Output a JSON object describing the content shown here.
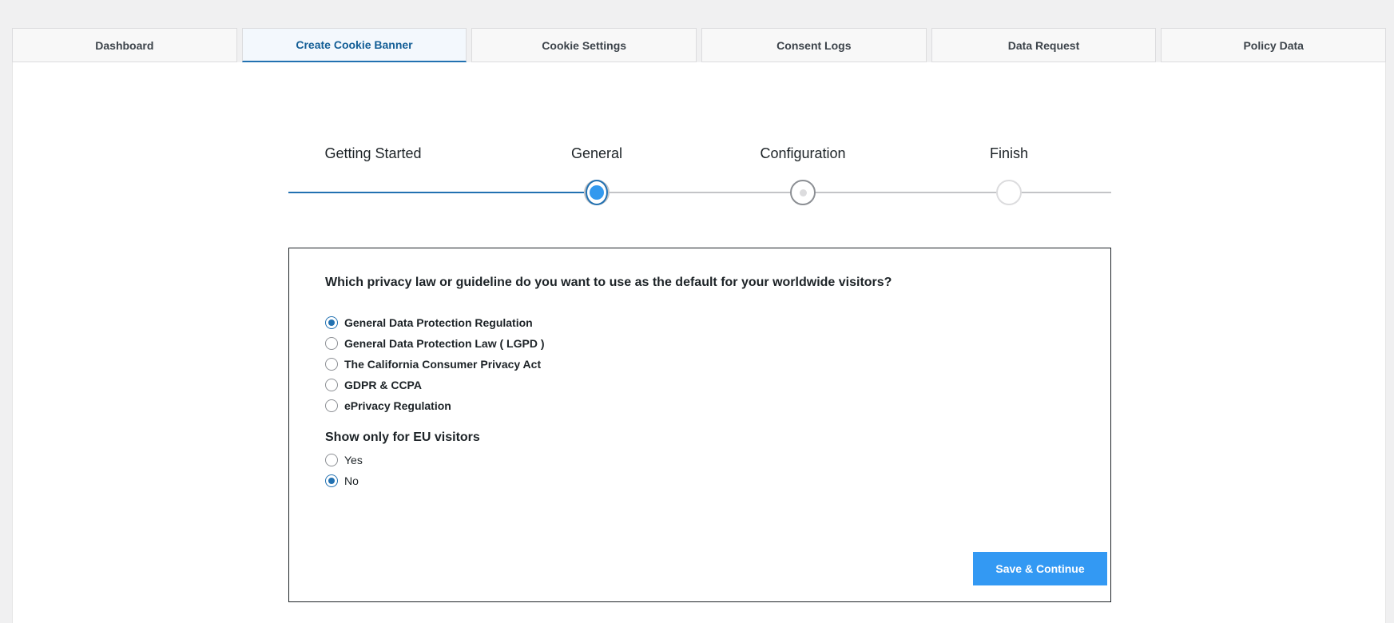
{
  "tabs": [
    {
      "label": "Dashboard",
      "active": false
    },
    {
      "label": "Create Cookie Banner",
      "active": true
    },
    {
      "label": "Cookie Settings",
      "active": false
    },
    {
      "label": "Consent Logs",
      "active": false
    },
    {
      "label": "Data Request",
      "active": false
    },
    {
      "label": "Policy Data",
      "active": false
    }
  ],
  "stepper": {
    "steps": [
      {
        "label": "Getting Started",
        "state": "done"
      },
      {
        "label": "General",
        "state": "current"
      },
      {
        "label": "Configuration",
        "state": "next"
      },
      {
        "label": "Finish",
        "state": "future"
      }
    ]
  },
  "form": {
    "question": "Which privacy law or guideline do you want to use as the default for your worldwide visitors?",
    "law_options": [
      {
        "label": "General Data Protection Regulation",
        "checked": true
      },
      {
        "label": "General Data Protection Law ( LGPD )",
        "checked": false
      },
      {
        "label": "The California Consumer Privacy Act",
        "checked": false
      },
      {
        "label": "GDPR & CCPA",
        "checked": false
      },
      {
        "label": "ePrivacy Regulation",
        "checked": false
      }
    ],
    "eu_title": "Show only for EU visitors",
    "eu_options": [
      {
        "label": "Yes",
        "checked": false
      },
      {
        "label": "No",
        "checked": true
      }
    ],
    "save_label": "Save & Continue"
  },
  "colors": {
    "accent": "#2271b1",
    "button": "#3399f3",
    "active_tab_text": "#135e96"
  }
}
